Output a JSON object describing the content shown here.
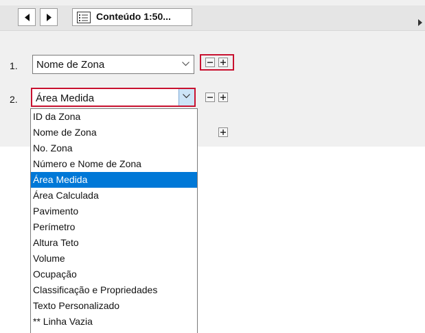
{
  "toolbar": {
    "content_label": "Conteúdo 1:50..."
  },
  "rows": [
    {
      "number": "1.",
      "value": "Nome de Zona"
    },
    {
      "number": "2.",
      "value": "Área Medida"
    }
  ],
  "dropdown": {
    "options": [
      "ID da Zona",
      "Nome de Zona",
      "No. Zona",
      "Número e Nome de Zona",
      "Área Medida",
      "Área Calculada",
      "Pavimento",
      "Perímetro",
      "Altura Teto",
      "Volume",
      "Ocupação",
      "Classificação e Propriedades",
      "Texto Personalizado",
      "** Linha Vazia"
    ],
    "selected_index": 4
  },
  "colors": {
    "highlight": "#c8102e",
    "selection": "#0078d7",
    "panel": "#f0f0f0"
  },
  "icons": [
    "triangle-left-icon",
    "triangle-right-icon",
    "list-icon",
    "chevron-down-icon",
    "minus-icon",
    "plus-icon"
  ]
}
